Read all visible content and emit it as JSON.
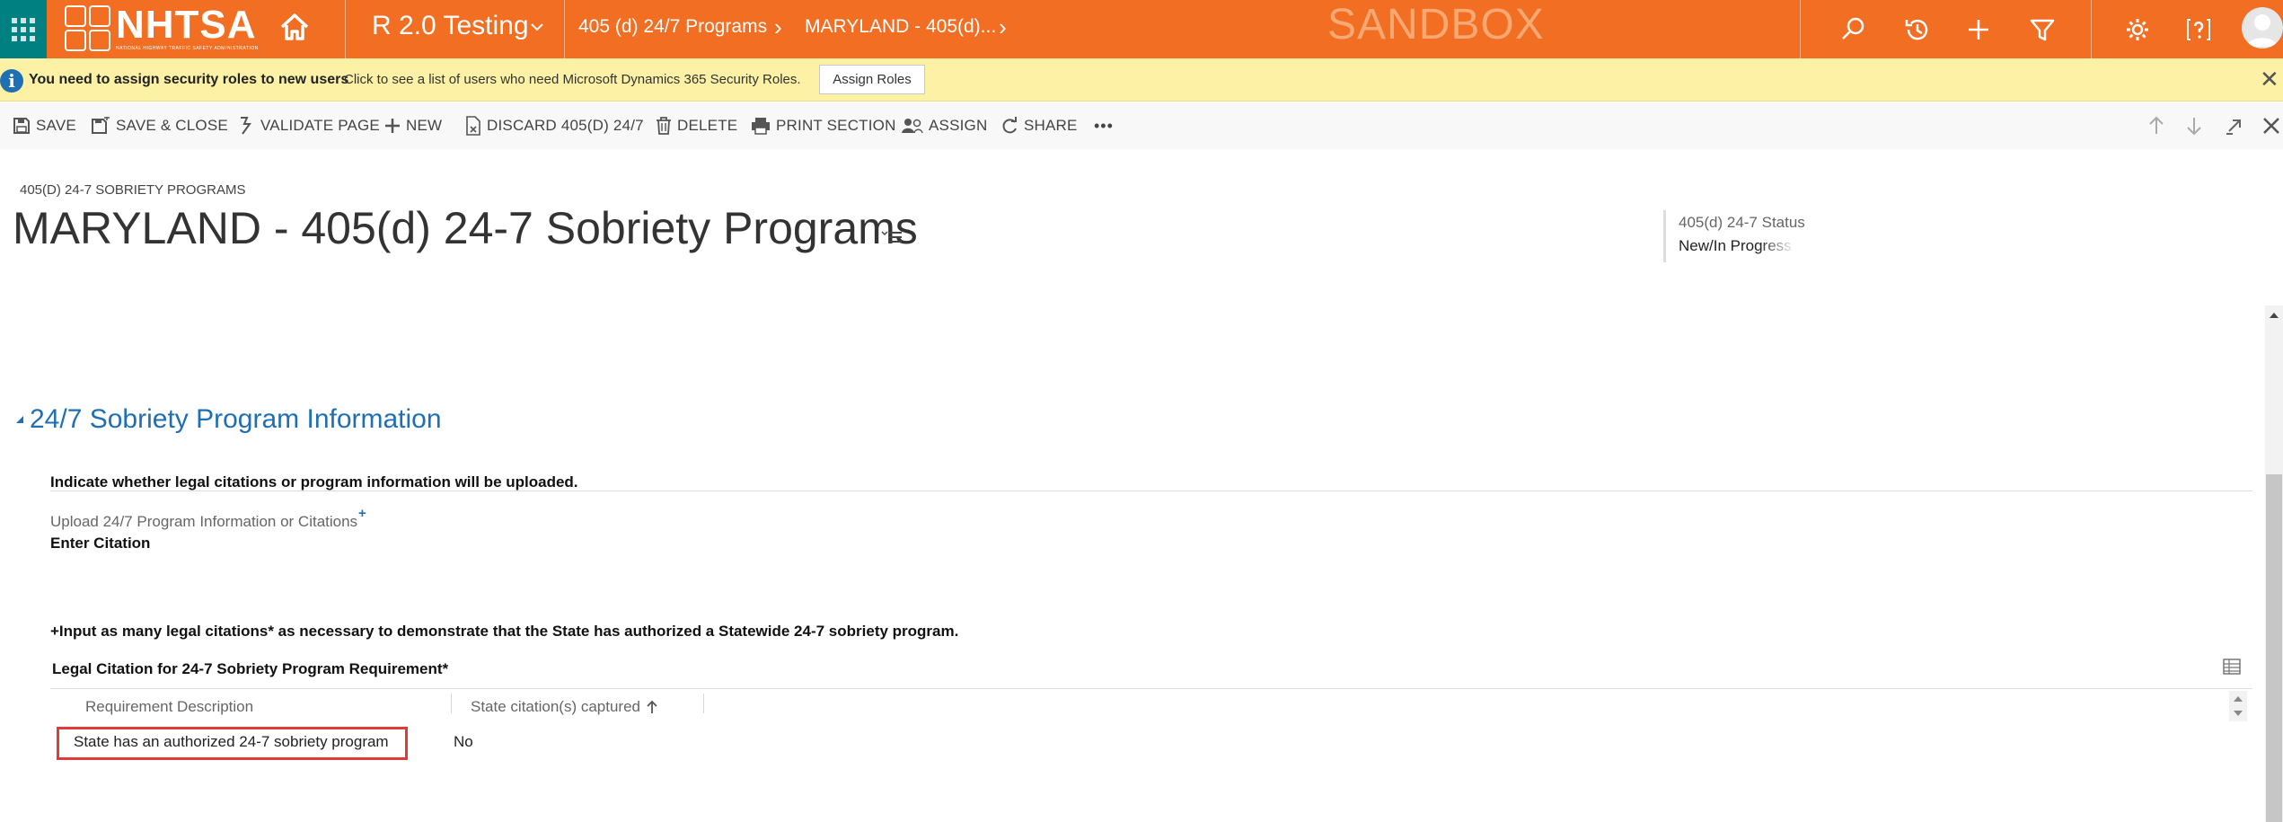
{
  "topbar": {
    "logo_text": "NHTSA",
    "logo_subtext": "NATIONAL HIGHWAY TRAFFIC SAFETY ADMINISTRATION",
    "app_title": "R 2.0 Testing",
    "breadcrumbs": [
      "405 (d) 24/7 Programs",
      "MARYLAND - 405(d)..."
    ],
    "environment_label": "SANDBOX",
    "icons": [
      "waffle-icon",
      "home-icon",
      "chevron-down-icon",
      "search-icon",
      "history-icon",
      "plus-icon",
      "filter-icon",
      "gear-icon",
      "help-icon",
      "user-avatar-icon"
    ],
    "colors": {
      "bar": "#f26e22",
      "waffle": "#008080"
    }
  },
  "notification": {
    "title": "You need to assign security roles to new users",
    "message": "Click to see a list of users who need Microsoft Dynamics 365 Security Roles.",
    "button_label": "Assign Roles",
    "close_symbol": "✕",
    "colors": {
      "background": "#fcf1a4",
      "info_icon": "#1f6fb5"
    }
  },
  "commands": {
    "save": "SAVE",
    "save_close": "SAVE & CLOSE",
    "validate": "VALIDATE PAGE",
    "new": "NEW",
    "discard": "DISCARD 405(D) 24/7",
    "delete": "DELETE",
    "print": "PRINT SECTION",
    "assign": "ASSIGN",
    "share": "SHARE",
    "more": "•••"
  },
  "header": {
    "entity_label": "405(D) 24-7 SOBRIETY PROGRAMS",
    "record_title": "MARYLAND - 405(d) 24-7 Sobriety Programs",
    "status_label": "405(d) 24-7 Status",
    "status_value": "New/In Progress"
  },
  "section": {
    "title": "24/7 Sobriety Program Information",
    "instruction": "Indicate whether legal citations or program information will be uploaded.",
    "upload_label": "Upload 24/7 Program Information or Citations",
    "required_marker": "+",
    "upload_value": "Enter Citation",
    "input_note": "+Input as many legal citations* as necessary to demonstrate that the State has authorized a Statewide 24-7 sobriety program.",
    "accent_color": "#1f6fb5"
  },
  "subgrid": {
    "title": "Legal Citation for 24-7 Sobriety Program Requirement*",
    "columns": [
      "Requirement Description",
      "State citation(s) captured"
    ],
    "sort_column": "State citation(s) captured",
    "rows": [
      {
        "requirement": "State has an authorized 24-7 sobriety program",
        "state_citations": "No"
      }
    ],
    "highlight_color": "#e03a3a"
  }
}
